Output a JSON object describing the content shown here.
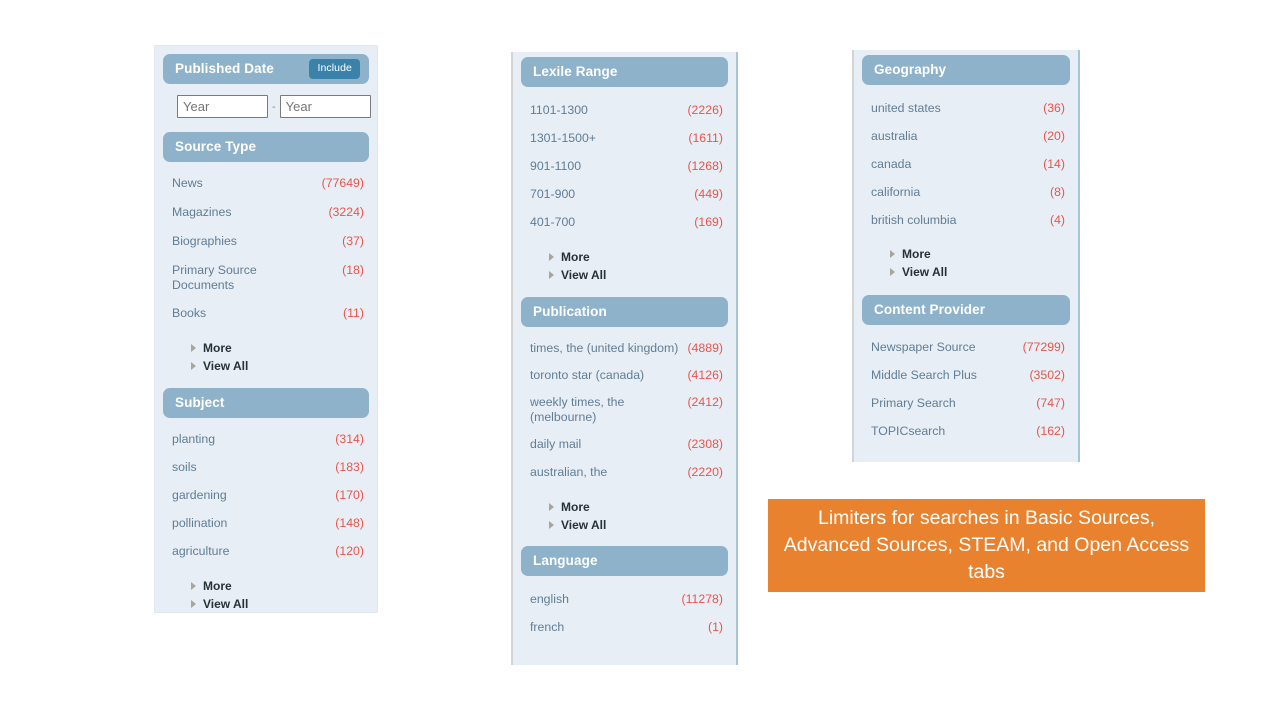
{
  "panels": {
    "left": {
      "groups": [
        {
          "title": "Published Date",
          "badge": "Include",
          "type": "year-range",
          "year_from": {
            "value": "",
            "placeholder": "Year"
          },
          "year_to": {
            "value": "",
            "placeholder": "Year"
          },
          "separator": "-"
        },
        {
          "title": "Source Type",
          "type": "facets",
          "items": [
            {
              "label": "News",
              "count": "(77649)"
            },
            {
              "label": "Magazines",
              "count": "(3224)"
            },
            {
              "label": "Biographies",
              "count": "(37)"
            },
            {
              "label": "Primary Source Documents",
              "count": "(18)"
            },
            {
              "label": "Books",
              "count": "(11)"
            }
          ],
          "more_label": "More",
          "view_all_label": "View All"
        },
        {
          "title": "Subject",
          "type": "facets",
          "items": [
            {
              "label": "planting",
              "count": "(314)"
            },
            {
              "label": "soils",
              "count": "(183)"
            },
            {
              "label": "gardening",
              "count": "(170)"
            },
            {
              "label": "pollination",
              "count": "(148)"
            },
            {
              "label": "agriculture",
              "count": "(120)"
            }
          ],
          "more_label": "More",
          "view_all_label": "View All"
        }
      ]
    },
    "mid": {
      "groups": [
        {
          "title": "Lexile Range",
          "type": "facets",
          "items": [
            {
              "label": "1101-1300",
              "count": "(2226)"
            },
            {
              "label": "1301-1500+",
              "count": "(1611)"
            },
            {
              "label": "901-1100",
              "count": "(1268)"
            },
            {
              "label": "701-900",
              "count": "(449)"
            },
            {
              "label": "401-700",
              "count": "(169)"
            }
          ],
          "more_label": "More",
          "view_all_label": "View All"
        },
        {
          "title": "Publication",
          "type": "facets",
          "items": [
            {
              "label": "times, the (united kingdom)",
              "count": "(4889)"
            },
            {
              "label": "toronto star (canada)",
              "count": "(4126)"
            },
            {
              "label": "weekly times, the (melbourne)",
              "count": "(2412)"
            },
            {
              "label": "daily mail",
              "count": "(2308)"
            },
            {
              "label": "australian, the",
              "count": "(2220)"
            }
          ],
          "more_label": "More",
          "view_all_label": "View All"
        },
        {
          "title": "Language",
          "type": "facets",
          "items": [
            {
              "label": "english",
              "count": "(11278)"
            },
            {
              "label": "french",
              "count": "(1)"
            }
          ]
        }
      ]
    },
    "right": {
      "groups": [
        {
          "title": "Geography",
          "type": "facets",
          "items": [
            {
              "label": "united states",
              "count": "(36)"
            },
            {
              "label": "australia",
              "count": "(20)"
            },
            {
              "label": "canada",
              "count": "(14)"
            },
            {
              "label": "california",
              "count": "(8)"
            },
            {
              "label": "british columbia",
              "count": "(4)"
            }
          ],
          "more_label": "More",
          "view_all_label": "View All"
        },
        {
          "title": "Content Provider",
          "type": "facets",
          "items": [
            {
              "label": "Newspaper Source",
              "count": "(77299)"
            },
            {
              "label": "Middle Search Plus",
              "count": "(3502)"
            },
            {
              "label": "Primary Search",
              "count": "(747)"
            },
            {
              "label": "TOPICsearch",
              "count": "(162)"
            }
          ]
        }
      ]
    }
  },
  "callout": {
    "text": "Limiters for searches in Basic Sources, Advanced Sources, STEAM, and Open Access tabs",
    "background": "#e8822f",
    "color": "#ffffff"
  },
  "colors": {
    "header_blue": "#8eb2ca",
    "panel_background": "#e8eef5",
    "facet_label": "#5f7d95",
    "facet_count": "#e8554d",
    "badge_blue": "#3b82ab"
  }
}
